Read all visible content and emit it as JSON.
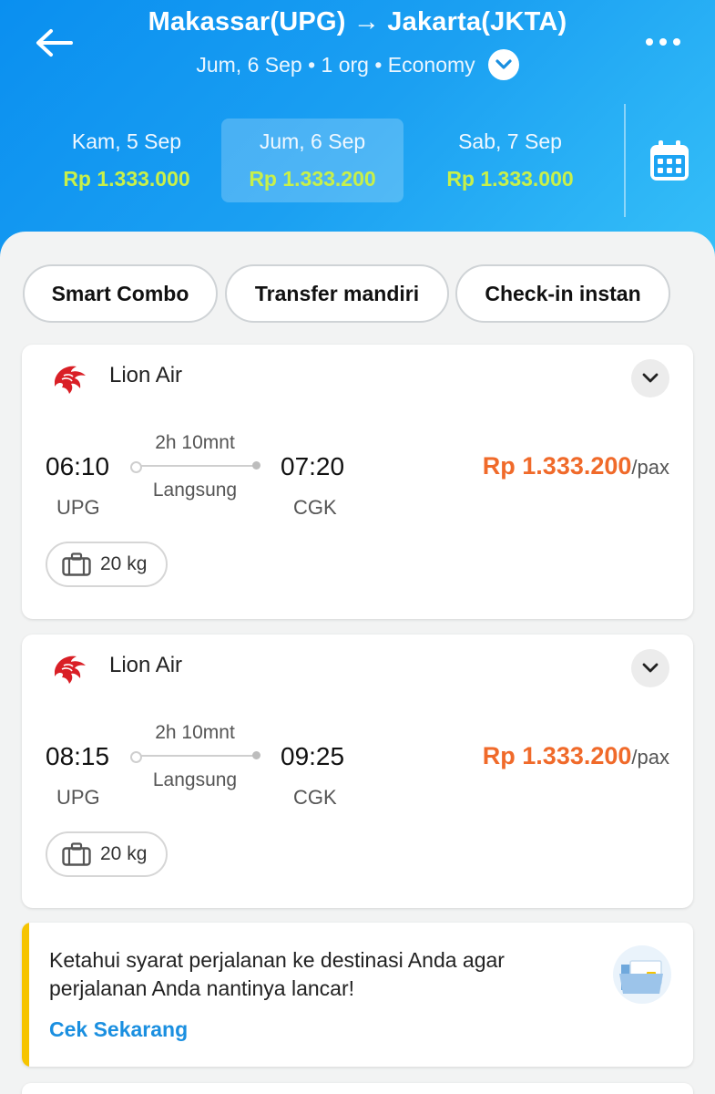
{
  "header": {
    "title": "Makassar(UPG) → Jakarta(JKTA)",
    "subtitle": "Jum, 6 Sep • 1 org • Economy"
  },
  "dates": [
    {
      "label": "Kam, 5 Sep",
      "price": "Rp 1.333.000",
      "active": false
    },
    {
      "label": "Jum, 6 Sep",
      "price": "Rp 1.333.200",
      "active": true
    },
    {
      "label": "Sab, 7 Sep",
      "price": "Rp 1.333.000",
      "active": false
    }
  ],
  "filters": [
    "Smart Combo",
    "Transfer mandiri",
    "Check-in instan"
  ],
  "flights": [
    {
      "airline": "Lion Air",
      "dep_time": "06:10",
      "dep_code": "UPG",
      "arr_time": "07:20",
      "arr_code": "CGK",
      "duration": "2h 10mnt",
      "stops": "Langsung",
      "price": "Rp 1.333.200",
      "per": "/pax",
      "baggage": "20 kg"
    },
    {
      "airline": "Lion Air",
      "dep_time": "08:15",
      "dep_code": "UPG",
      "arr_time": "09:25",
      "arr_code": "CGK",
      "duration": "2h 10mnt",
      "stops": "Langsung",
      "price": "Rp 1.333.200",
      "per": "/pax",
      "baggage": "20 kg"
    }
  ],
  "info": {
    "text": "Ketahui syarat perjalanan ke destinasi Anda agar perjalanan Anda nantinya lancar!",
    "link": "Cek Sekarang"
  },
  "icons": {
    "back": "back-arrow-icon",
    "more": "more-dots-icon",
    "calendar": "calendar-icon",
    "airline": "lion-air-logo",
    "baggage": "suitcase-icon",
    "expand": "chevron-down-icon",
    "info": "folder-icon"
  },
  "colors": {
    "header_gradient_start": "#0a8ff0",
    "header_gradient_end": "#36c0f8",
    "date_price": "#c8f04a",
    "flight_price": "#f06a2a",
    "link": "#1a8fe0",
    "info_accent": "#f6c400",
    "airline_logo": "#d91f26"
  }
}
